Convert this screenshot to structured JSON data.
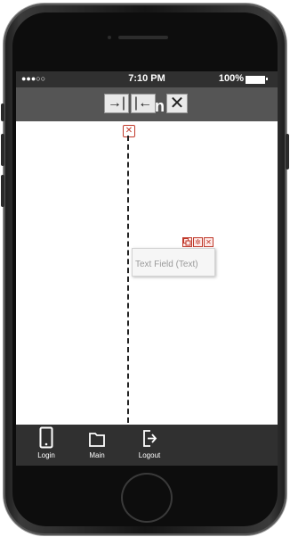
{
  "status_bar": {
    "signal": "●●●○○",
    "time": "7:10 PM",
    "battery": "100%"
  },
  "toolbar": {
    "indent_right_icon": "→|",
    "indent_left_icon": "|←",
    "hidden_letter": "n",
    "close_icon": "✕"
  },
  "canvas": {
    "delete_marker": "✕",
    "text_field": {
      "placeholder": "Text Field (Text)",
      "controls": [
        "copy-icon",
        "gear-icon",
        "close-icon"
      ]
    }
  },
  "tab_bar": {
    "items": [
      {
        "label": "Login",
        "icon": "phone-icon"
      },
      {
        "label": "Main",
        "icon": "folder-icon"
      },
      {
        "label": "Logout",
        "icon": "logout-icon"
      }
    ]
  },
  "colors": {
    "status_bar": "#303030",
    "nav_bar": "#555555",
    "accent": "#c0392b",
    "tab_bar": "#303030"
  }
}
